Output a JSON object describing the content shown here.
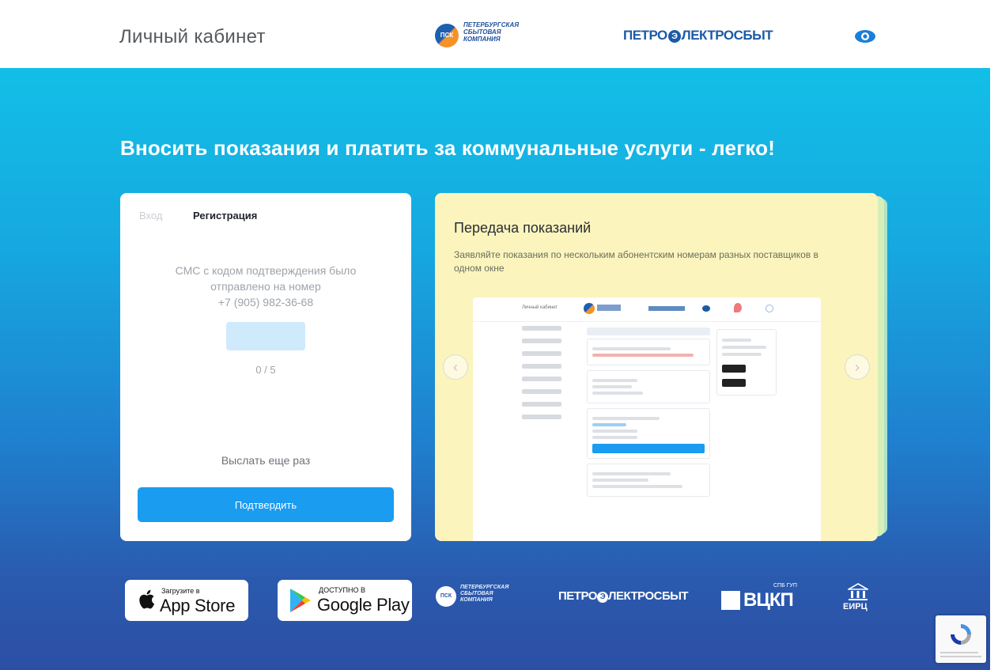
{
  "header": {
    "title": "Личный кабинет",
    "psk_logo": {
      "initials": "ПСК",
      "lines": [
        "ПЕТЕРБУРГСКАЯ",
        "СБЫТОВАЯ",
        "КОМПАНИЯ"
      ]
    },
    "pes_logo": {
      "left": "ПЕТРО",
      "right": "ЛЕКТРОСБЫТ",
      "mark": "Э"
    },
    "accessibility_icon": "eye-icon"
  },
  "headline": "Вносить показания и платить за коммунальные услуги - легко!",
  "auth_card": {
    "tabs": [
      {
        "label": "Вход",
        "active": false
      },
      {
        "label": "Регистрация",
        "active": true
      }
    ],
    "sms_lines": [
      "СМС с кодом подтверждения было",
      "отправлено на номер",
      "+7 (905) 982-36-68"
    ],
    "code_input": {
      "value": "",
      "placeholder": ""
    },
    "counter": "0 / 5",
    "resend": "Выслать еще раз",
    "confirm": "Подтвердить"
  },
  "promo": {
    "title": "Передача показаний",
    "description": "Заявляйте показания по нескольким абонентским номерам разных поставщиков в одном окне",
    "prev_icon": "chevron-left-icon",
    "next_icon": "chevron-right-icon",
    "preview_title": "Личный кабинет"
  },
  "footer": {
    "app_store": {
      "small": "Загрузите в",
      "big": "App Store"
    },
    "google_play": {
      "small": "ДОСТУПНО В",
      "big": "Google Play"
    },
    "psk": {
      "initials": "ПСК",
      "lines": [
        "ПЕТЕРБУРГСКАЯ",
        "СБЫТОВАЯ",
        "КОМПАНИЯ"
      ]
    },
    "pes": {
      "left": "ПЕТРО",
      "right": "ЛЕКТРОСБЫТ",
      "mark": "Э"
    },
    "vckp": {
      "text": "ВЦКП",
      "small": "СПБ ГУП"
    },
    "eirc": {
      "text": "ЕИРЦ"
    }
  },
  "colors": {
    "accent": "#1a9cf0",
    "gradient_top": "#12bfe6",
    "gradient_bottom": "#2c4fa4",
    "promo_bg": "#fbf4bd"
  }
}
